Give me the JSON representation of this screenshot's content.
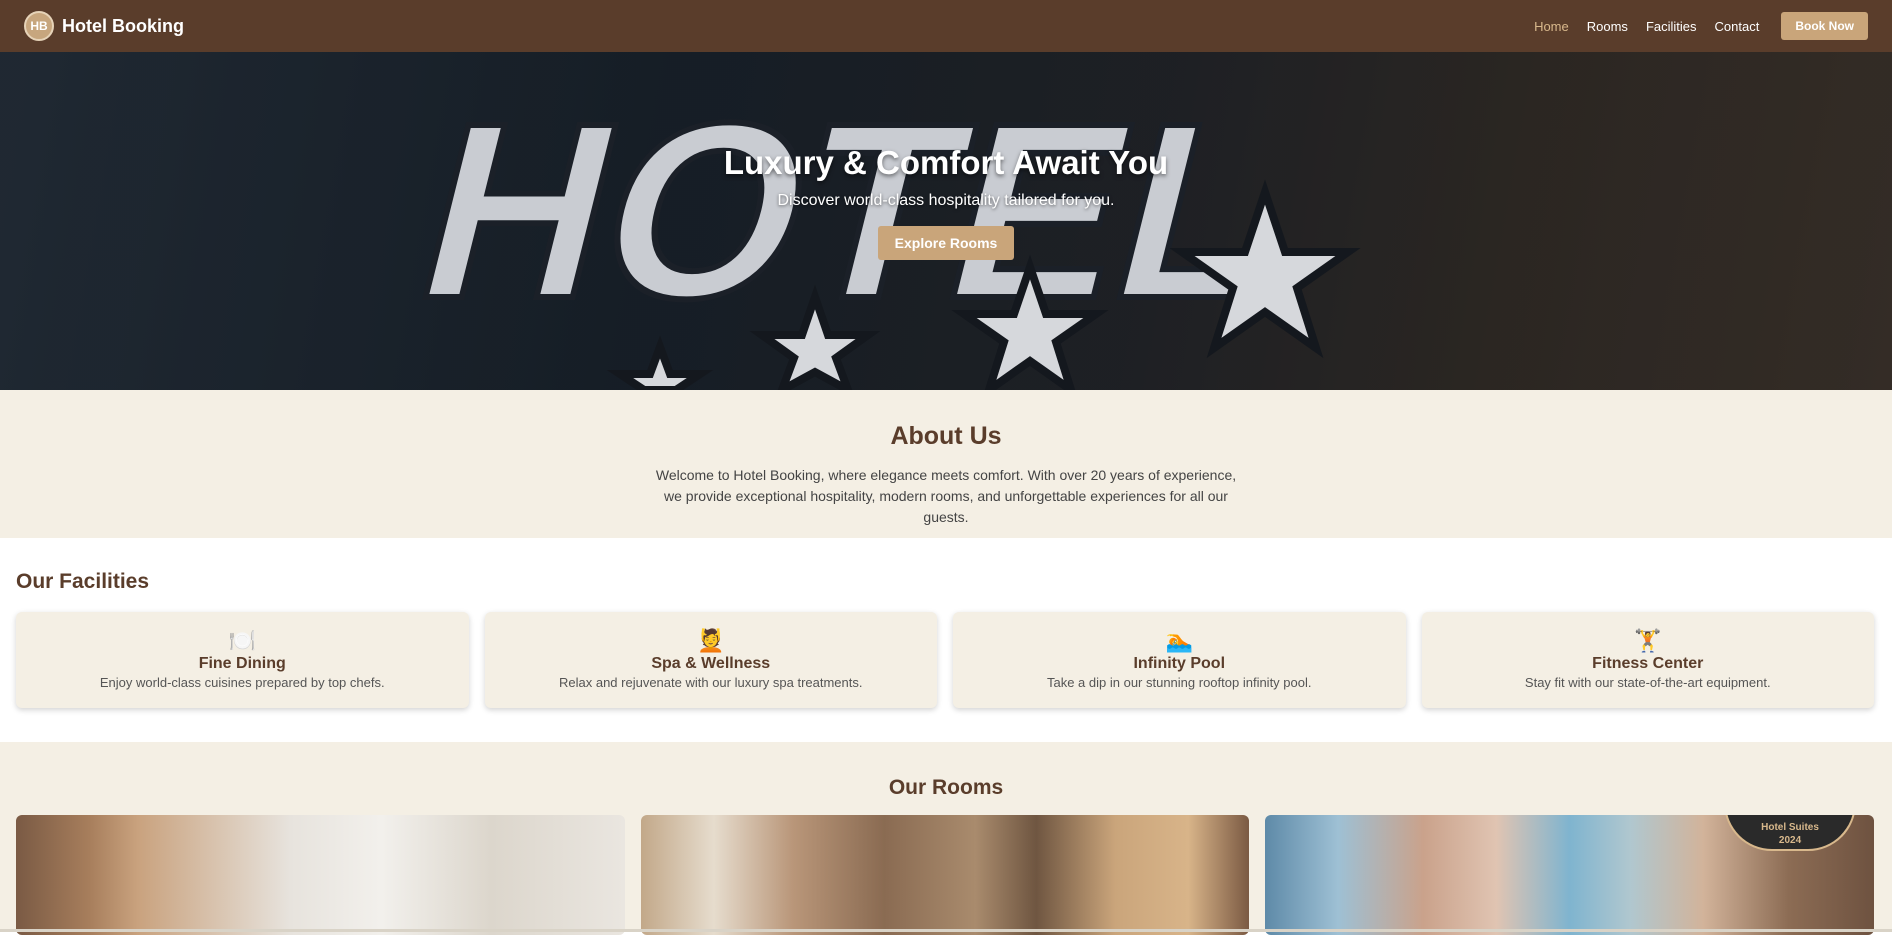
{
  "brand": {
    "logo_text": "HB",
    "name": "Hotel Booking"
  },
  "nav": {
    "links": [
      "Home",
      "Rooms",
      "Facilities",
      "Contact"
    ],
    "active": "Home",
    "cta": "Book Now"
  },
  "hero": {
    "title": "Luxury & Comfort Await You",
    "subtitle": "Discover world-class hospitality tailored for you.",
    "button": "Explore Rooms",
    "sign_text": "HOTEL"
  },
  "about": {
    "title": "About Us",
    "text": "Welcome to Hotel Booking, where elegance meets comfort. With over 20 years of experience, we provide exceptional hospitality, modern rooms, and unforgettable experiences for all our guests."
  },
  "facilities": {
    "title": "Our Facilities",
    "items": [
      {
        "icon": "🍽️",
        "name": "Fine Dining",
        "desc": "Enjoy world-class cuisines prepared by top chefs."
      },
      {
        "icon": "💆",
        "name": "Spa & Wellness",
        "desc": "Relax and rejuvenate with our luxury spa treatments."
      },
      {
        "icon": "🏊",
        "name": "Infinity Pool",
        "desc": "Take a dip in our stunning rooftop infinity pool."
      },
      {
        "icon": "🏋️",
        "name": "Fitness Center",
        "desc": "Stay fit with our state-of-the-art equipment."
      }
    ]
  },
  "rooms": {
    "title": "Our Rooms",
    "badge_line1": "Hotel Suites",
    "badge_line2": "2024"
  },
  "colors": {
    "nav_bg": "#5a3d2b",
    "accent": "#c9a57a",
    "section_bg": "#f4efe4",
    "heading": "#5a3d2b"
  }
}
